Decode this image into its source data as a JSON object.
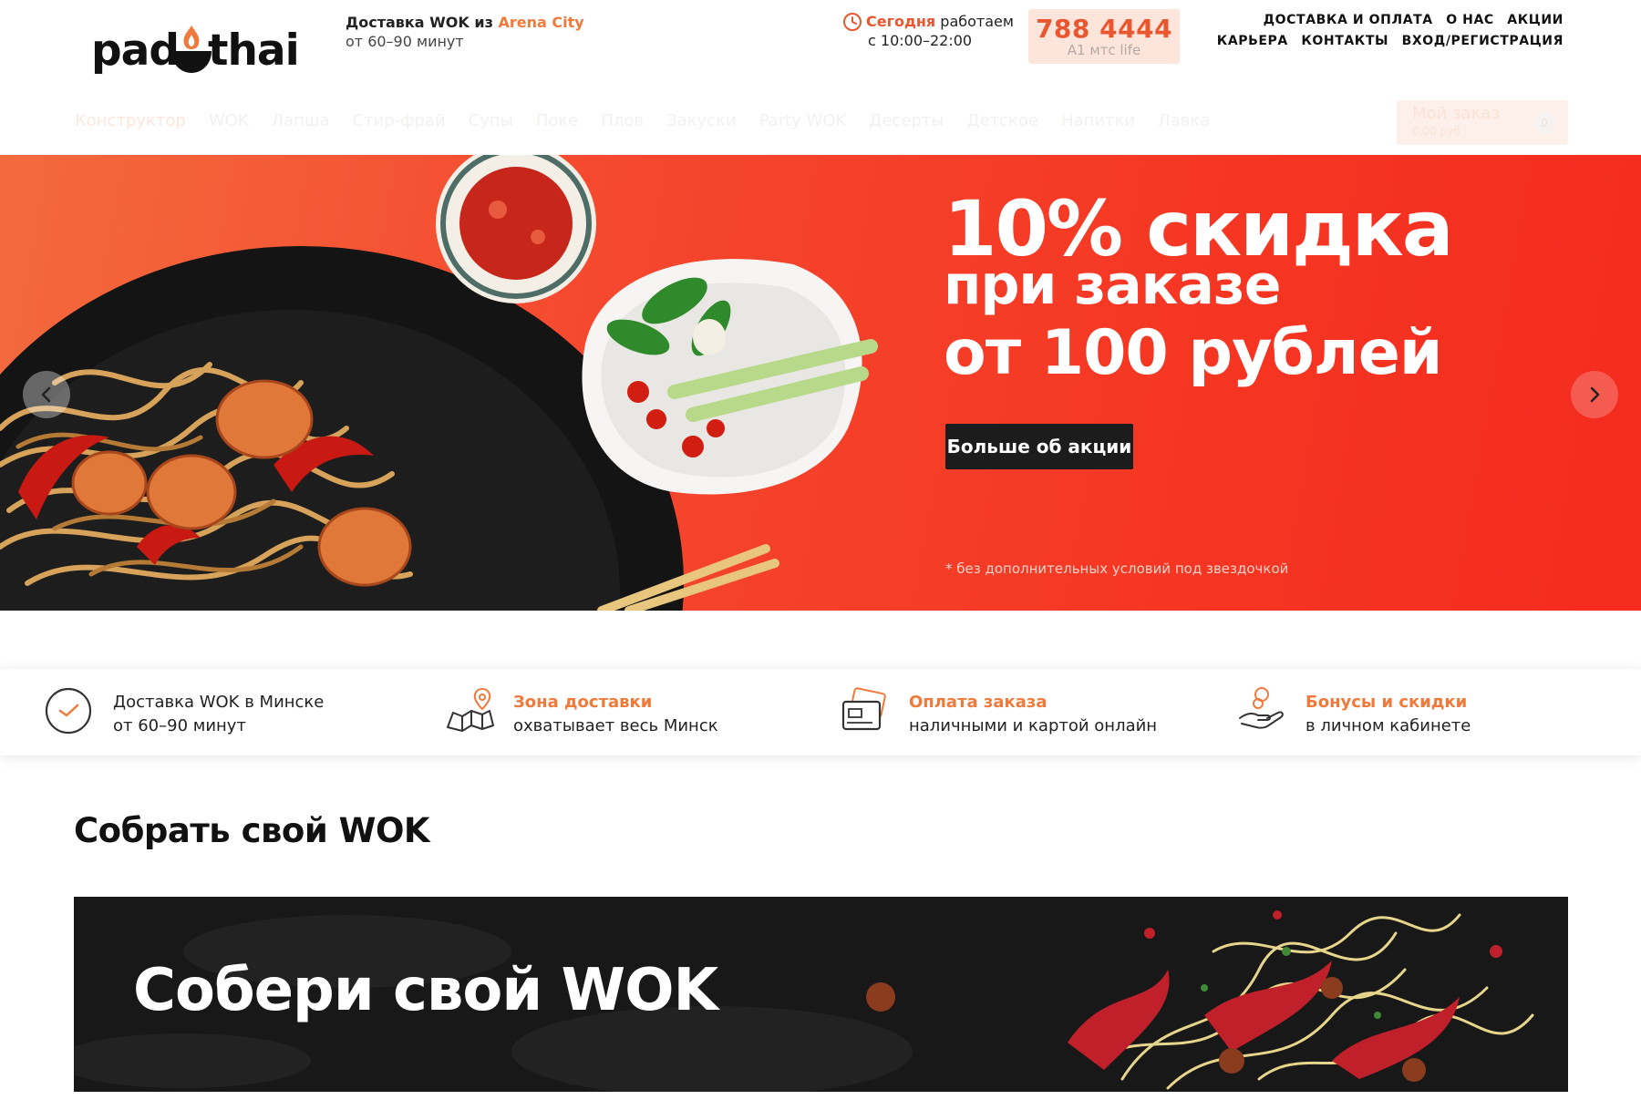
{
  "header": {
    "logo": {
      "text_left": "pad",
      "text_right": "thai"
    },
    "delivery": {
      "prefix": "Доставка WOK из",
      "location": "Arena City",
      "time": "от 60–90 минут"
    },
    "hours": {
      "today_label": "Сегодня",
      "status": "работаем",
      "range": "с 10:00–22:00"
    },
    "phone": {
      "number": "788 4444",
      "operators": "A1 мтс life"
    },
    "top_nav": [
      {
        "label": "ДОСТАВКА И ОПЛАТА"
      },
      {
        "label": "О НАС"
      },
      {
        "label": "АКЦИИ"
      },
      {
        "label": "КАРЬЕРА"
      },
      {
        "label": "КОНТАКТЫ"
      },
      {
        "label": "ВХОД/РЕГИСТРАЦИЯ"
      }
    ],
    "categories": [
      {
        "label": "Конструктор",
        "active": true
      },
      {
        "label": "WOK"
      },
      {
        "label": "Лапша"
      },
      {
        "label": "Стир-фрай"
      },
      {
        "label": "Супы"
      },
      {
        "label": "Поке"
      },
      {
        "label": "Плов"
      },
      {
        "label": "Закуски"
      },
      {
        "label": "Party WOK"
      },
      {
        "label": "Десерты"
      },
      {
        "label": "Детское"
      },
      {
        "label": "Напитки"
      },
      {
        "label": "Лавка"
      }
    ],
    "cart": {
      "title": "Мой заказ",
      "subtitle": "0.00 руб",
      "count": "0"
    }
  },
  "hero": {
    "headline_1": "10% скидка",
    "headline_2": "при заказе",
    "headline_3": "от 100 рублей",
    "button_label": "Больше об акции",
    "footnote": "* без дополнительных условий под звездочкой"
  },
  "features": [
    {
      "icon": "clock-icon",
      "title": "Доставка WOK в Минске",
      "subtitle": "от 60–90 минут"
    },
    {
      "icon": "map-icon",
      "title": "Зона доставки",
      "subtitle": "охватывает весь Минск"
    },
    {
      "icon": "credit-card-icon",
      "title": "Оплата заказа",
      "subtitle": "наличными и картой онлайн"
    },
    {
      "icon": "hand-coin-icon",
      "title": "Бонусы и скидки",
      "subtitle": "в личном кабинете"
    }
  ],
  "section": {
    "title": "Собрать свой WOK",
    "banner_title": "Собери свой WOK"
  },
  "colors": {
    "accent": "#ef7a3b",
    "brand_red": "#f53723",
    "dark": "#1c1c1c"
  }
}
